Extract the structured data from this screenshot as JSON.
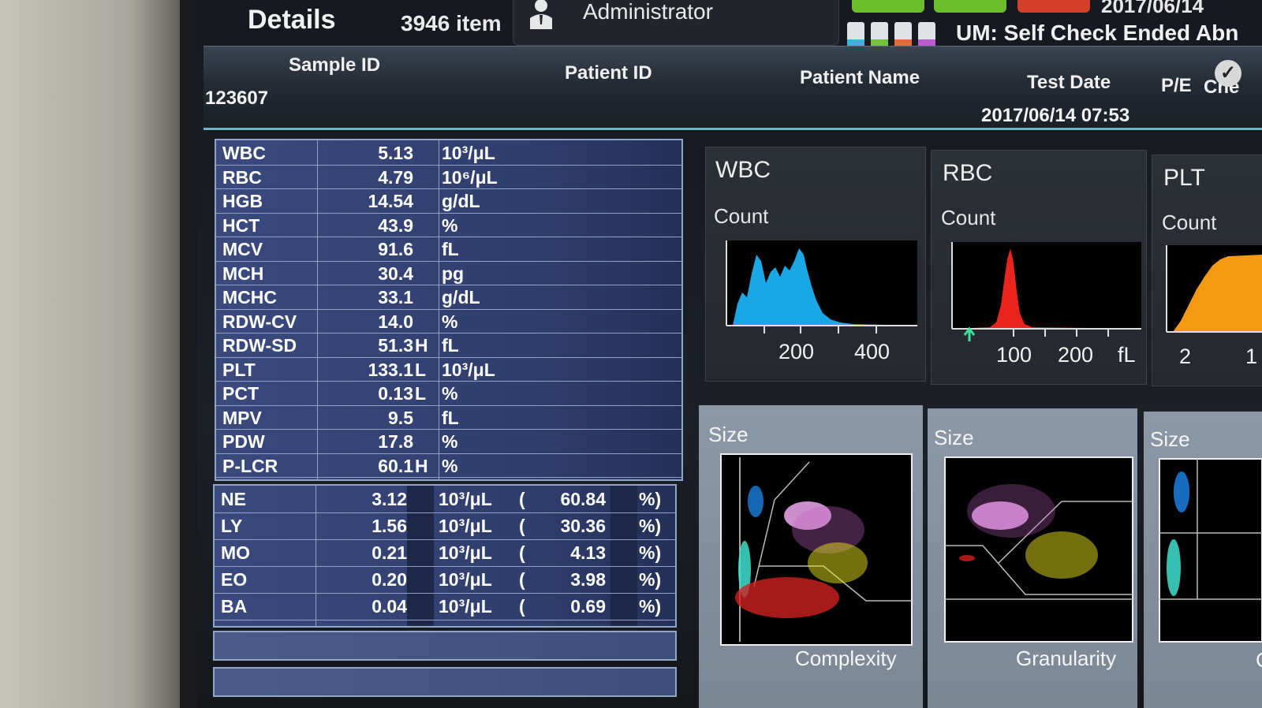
{
  "header": {
    "title": "Details",
    "item_count": "3946 item",
    "user": "Administrator",
    "status": "UM: Self Check Ended Abn",
    "date": "2017/06/14"
  },
  "sample": {
    "columns": [
      "Sample ID",
      "Patient ID",
      "Patient Name",
      "Test Date",
      "P/E",
      "Che"
    ],
    "sample_id": "123607",
    "test_date": "2017/06/14 07:53"
  },
  "results": [
    {
      "name": "WBC",
      "value": "5.13",
      "flag": "",
      "unit": "10³/μL"
    },
    {
      "name": "RBC",
      "value": "4.79",
      "flag": "",
      "unit": "10⁶/μL"
    },
    {
      "name": "HGB",
      "value": "14.54",
      "flag": "",
      "unit": "g/dL"
    },
    {
      "name": "HCT",
      "value": "43.9",
      "flag": "",
      "unit": "%"
    },
    {
      "name": "MCV",
      "value": "91.6",
      "flag": "",
      "unit": "fL"
    },
    {
      "name": "MCH",
      "value": "30.4",
      "flag": "",
      "unit": "pg"
    },
    {
      "name": "MCHC",
      "value": "33.1",
      "flag": "",
      "unit": "g/dL"
    },
    {
      "name": "RDW-CV",
      "value": "14.0",
      "flag": "",
      "unit": "%"
    },
    {
      "name": "RDW-SD",
      "value": "51.3",
      "flag": "H",
      "unit": "fL"
    },
    {
      "name": "PLT",
      "value": "133.1",
      "flag": "L",
      "unit": "10³/μL"
    },
    {
      "name": "PCT",
      "value": "0.13",
      "flag": "L",
      "unit": "%"
    },
    {
      "name": "MPV",
      "value": "9.5",
      "flag": "",
      "unit": "fL"
    },
    {
      "name": "PDW",
      "value": "17.8",
      "flag": "",
      "unit": "%"
    },
    {
      "name": "P-LCR",
      "value": "60.1",
      "flag": "H",
      "unit": "%"
    }
  ],
  "differential": [
    {
      "name": "NE",
      "value": "3.12",
      "unit": "10³/μL",
      "paren": "(",
      "percent": "60.84",
      "pct_unit": "%)"
    },
    {
      "name": "LY",
      "value": "1.56",
      "unit": "10³/μL",
      "paren": "(",
      "percent": "30.36",
      "pct_unit": "%)"
    },
    {
      "name": "MO",
      "value": "0.21",
      "unit": "10³/μL",
      "paren": "(",
      "percent": "4.13",
      "pct_unit": "%)"
    },
    {
      "name": "EO",
      "value": "0.20",
      "unit": "10³/μL",
      "paren": "(",
      "percent": "3.98",
      "pct_unit": "%)"
    },
    {
      "name": "BA",
      "value": "0.04",
      "unit": "10³/μL",
      "paren": "(",
      "percent": "0.69",
      "pct_unit": "%)"
    }
  ],
  "histograms": {
    "wbc": {
      "title": "WBC",
      "ylabel": "Count",
      "ticks": [
        "200",
        "400"
      ],
      "color": "#1aa7e6"
    },
    "rbc": {
      "title": "RBC",
      "ylabel": "Count",
      "ticks": [
        "100",
        "200",
        "fL"
      ],
      "color": "#e8241c"
    },
    "plt": {
      "title": "PLT",
      "ylabel": "Count",
      "ticks": [
        "2",
        "1"
      ],
      "color": "#f39a12"
    }
  },
  "scattergrams": {
    "s1": {
      "ylabel": "Size",
      "xlabel": "Complexity"
    },
    "s2": {
      "ylabel": "Size",
      "xlabel": "Granularity"
    },
    "s3": {
      "ylabel": "Size",
      "xlabel": "C"
    }
  }
}
